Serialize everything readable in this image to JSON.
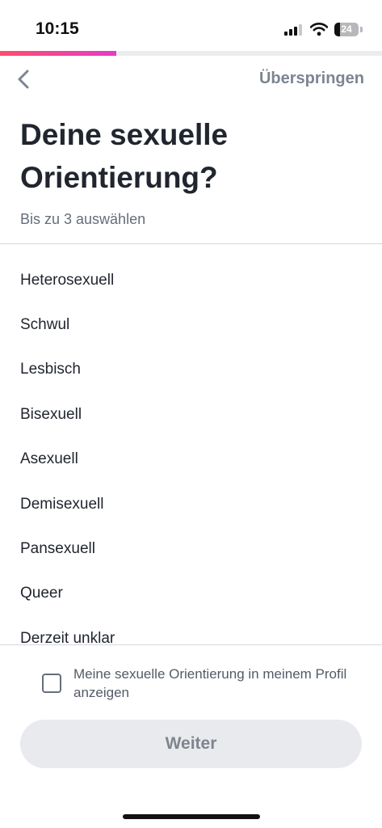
{
  "status_bar": {
    "time": "10:15",
    "battery": "24"
  },
  "progress": {
    "fraction": 0.305
  },
  "header": {
    "skip_label": "Überspringen"
  },
  "main": {
    "title": "Deine sexuelle Orientierung?",
    "subtitle": "Bis zu 3 auswählen",
    "options": [
      "Heterosexuell",
      "Schwul",
      "Lesbisch",
      "Bisexuell",
      "Asexuell",
      "Demisexuell",
      "Pansexuell",
      "Queer",
      "Derzeit unklar"
    ]
  },
  "footer": {
    "show_on_profile_label": "Meine sexuelle Orientierung in meinem Profil anzeigen",
    "show_on_profile_checked": false,
    "continue_label": "Weiter"
  },
  "colors": {
    "accent_start": "#fd4e6c",
    "accent_end": "#e53bc8",
    "text": "#21262e"
  }
}
